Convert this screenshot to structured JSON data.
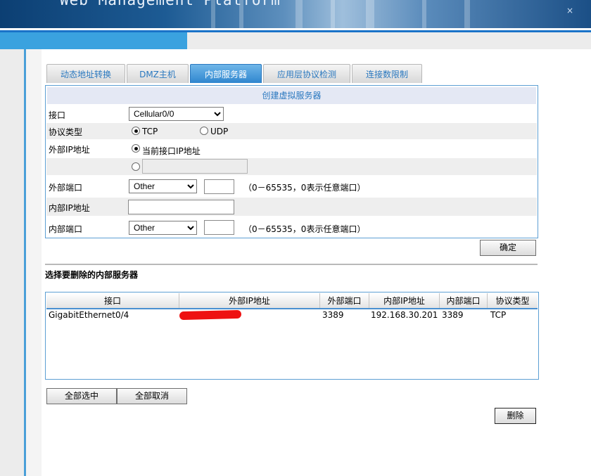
{
  "header": {
    "title": "Web Management Platform",
    "close_glyph": "×"
  },
  "tabs": [
    {
      "label": "动态地址转换",
      "active": false
    },
    {
      "label": "DMZ主机",
      "active": false
    },
    {
      "label": "内部服务器",
      "active": true
    },
    {
      "label": "应用层协议检测",
      "active": false
    },
    {
      "label": "连接数限制",
      "active": false
    }
  ],
  "form": {
    "heading": "创建虚拟服务器",
    "interface": {
      "label": "接口",
      "value": "Cellular0/0"
    },
    "protocol": {
      "label": "协议类型",
      "options": [
        "TCP",
        "UDP"
      ],
      "selected": "TCP"
    },
    "external_ip": {
      "label": "外部IP地址",
      "option_current": "当前接口IP地址",
      "selected": "current",
      "custom_value": ""
    },
    "external_port": {
      "label": "外部端口",
      "select_value": "Other",
      "port_value": "",
      "hint": "（0－65535，0表示任意端口）"
    },
    "internal_ip": {
      "label": "内部IP地址",
      "value": ""
    },
    "internal_port": {
      "label": "内部端口",
      "select_value": "Other",
      "port_value": "",
      "hint": "（0－65535，0表示任意端口）"
    },
    "confirm_label": "确定"
  },
  "delete_section": {
    "title": "选择要删除的内部服务器",
    "columns": [
      "接口",
      "外部IP地址",
      "外部端口",
      "内部IP地址",
      "内部端口",
      "协议类型"
    ],
    "rows": [
      {
        "interface": "GigabitEthernet0/4",
        "external_ip": "",
        "external_port": "3389",
        "internal_ip": "192.168.30.201",
        "internal_port": "3389",
        "protocol": "TCP"
      }
    ],
    "select_all_label": "全部选中",
    "deselect_all_label": "全部取消",
    "delete_label": "删除"
  },
  "colors": {
    "accent": "#2a78bf",
    "active_tab": "#3f95d9",
    "border_blue": "#5d9fd3",
    "redaction": "#ee1111"
  }
}
